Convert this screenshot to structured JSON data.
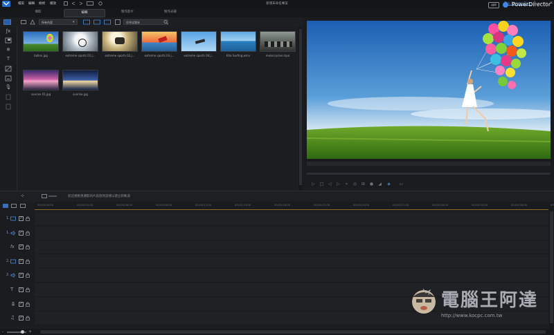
{
  "menu": {
    "items": [
      "檔案",
      "編輯",
      "檢視",
      "播放"
    ]
  },
  "window": {
    "title": "新增未命名專案",
    "login": "登入 DirectorZone",
    "controls": [
      "?",
      "—",
      "▭",
      "✕"
    ]
  },
  "modes": {
    "tabs": [
      "擷取",
      "編輯",
      "製作影片",
      "製作光碟"
    ],
    "active": 1
  },
  "brand": {
    "badge": "APP",
    "name": "PowerDirector",
    "accent": "#3f86e6"
  },
  "library": {
    "filter": "所有內容",
    "search_placeholder": "搜尋媒體庫",
    "items": [
      {
        "label": "ballon.jpg",
        "thumb": "balloons"
      },
      {
        "label": "extreme sports 01.j...",
        "thumb": "bmx"
      },
      {
        "label": "extreme sports 02.j...",
        "thumb": "motocross"
      },
      {
        "label": "extreme sports 03.j...",
        "thumb": "kite-sunset"
      },
      {
        "label": "extreme sports 04.j...",
        "thumb": "skydive"
      },
      {
        "label": "Kite Surfing.wmv",
        "thumb": "sea"
      },
      {
        "label": "motorcycles.mpo",
        "thumb": "motorcycles"
      },
      {
        "label": "sunrise 01.jpg",
        "thumb": "sunrise-pink"
      },
      {
        "label": "sunrise.jpg",
        "thumb": "sunrise-blue"
      }
    ]
  },
  "tools": [
    "media-room",
    "fx-room",
    "pip-room",
    "particle-room",
    "title-room",
    "transition-room",
    "subtitle-room",
    "voice-room",
    "chapter-room",
    "audio-mixing-room"
  ],
  "timeline": {
    "hint": "從這裡拖曳選取的片段放到這裡以建立新軌道",
    "ruler": [
      "00;00;00;00",
      "00;00;03;00",
      "00;00;06;00",
      "00;00;09;00",
      "00;00;12;00",
      "00;00;15;00",
      "00;00;18;00",
      "00;00;21;00",
      "00;00;24;00",
      "00;00;27;00",
      "00;00;30;00",
      "00;00;33;00",
      "00;00;36;00",
      "00;00;39;00"
    ],
    "tracks": [
      {
        "num": "1.",
        "icon": "video-track-icon",
        "checked": "✓"
      },
      {
        "num": "1.",
        "icon": "audio-track-icon",
        "checked": "✓"
      },
      {
        "num": "",
        "icon": "fx-track-icon",
        "checked": "✓"
      },
      {
        "num": "2.",
        "icon": "video-track-icon",
        "checked": "✓"
      },
      {
        "num": "2.",
        "icon": "audio-track-icon",
        "checked": "✓"
      },
      {
        "num": "",
        "icon": "title-track-icon",
        "checked": "✓"
      },
      {
        "num": "",
        "icon": "voice-track-icon",
        "checked": "✓"
      },
      {
        "num": "",
        "icon": "music-track-icon",
        "checked": "✓"
      }
    ]
  },
  "watermark": {
    "title": "電腦王阿達",
    "url": "http://www.kocpc.com.tw"
  }
}
